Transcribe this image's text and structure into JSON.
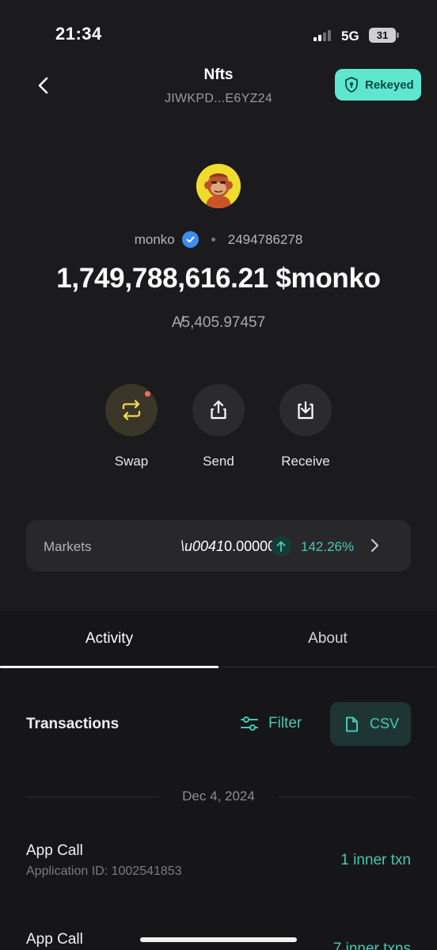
{
  "status_bar": {
    "time": "21:34",
    "network": "5G",
    "battery": "31"
  },
  "header": {
    "title": "Nfts",
    "address": "JIWKPD...E6YZ24",
    "rekeyed_label": "Rekeyed"
  },
  "asset": {
    "name": "monko",
    "asset_id": "2494786278",
    "balance": "1,749,788,616.21 $monko",
    "algo_value": "A̸⁠5,405.97457"
  },
  "actions": {
    "swap": "Swap",
    "send": "Send",
    "receive": "Receive"
  },
  "markets": {
    "label": "Markets",
    "price": "0.000003",
    "change": "142.26%"
  },
  "tabs": {
    "activity": "Activity",
    "about": "About"
  },
  "transactions": {
    "title": "Transactions",
    "filter_label": "Filter",
    "csv_label": "CSV",
    "date": "Dec 4, 2024",
    "items": [
      {
        "name": "App Call",
        "sub": "Application ID: 1002541853",
        "right": "1 inner txn"
      },
      {
        "name": "App Call",
        "sub": "",
        "right": "7 inner txns"
      }
    ]
  },
  "colors": {
    "accent": "#43c8b4",
    "rekeyed_bg": "#5fe6cf",
    "verified": "#3d8cf1",
    "swap_icon": "#f0d84a"
  }
}
